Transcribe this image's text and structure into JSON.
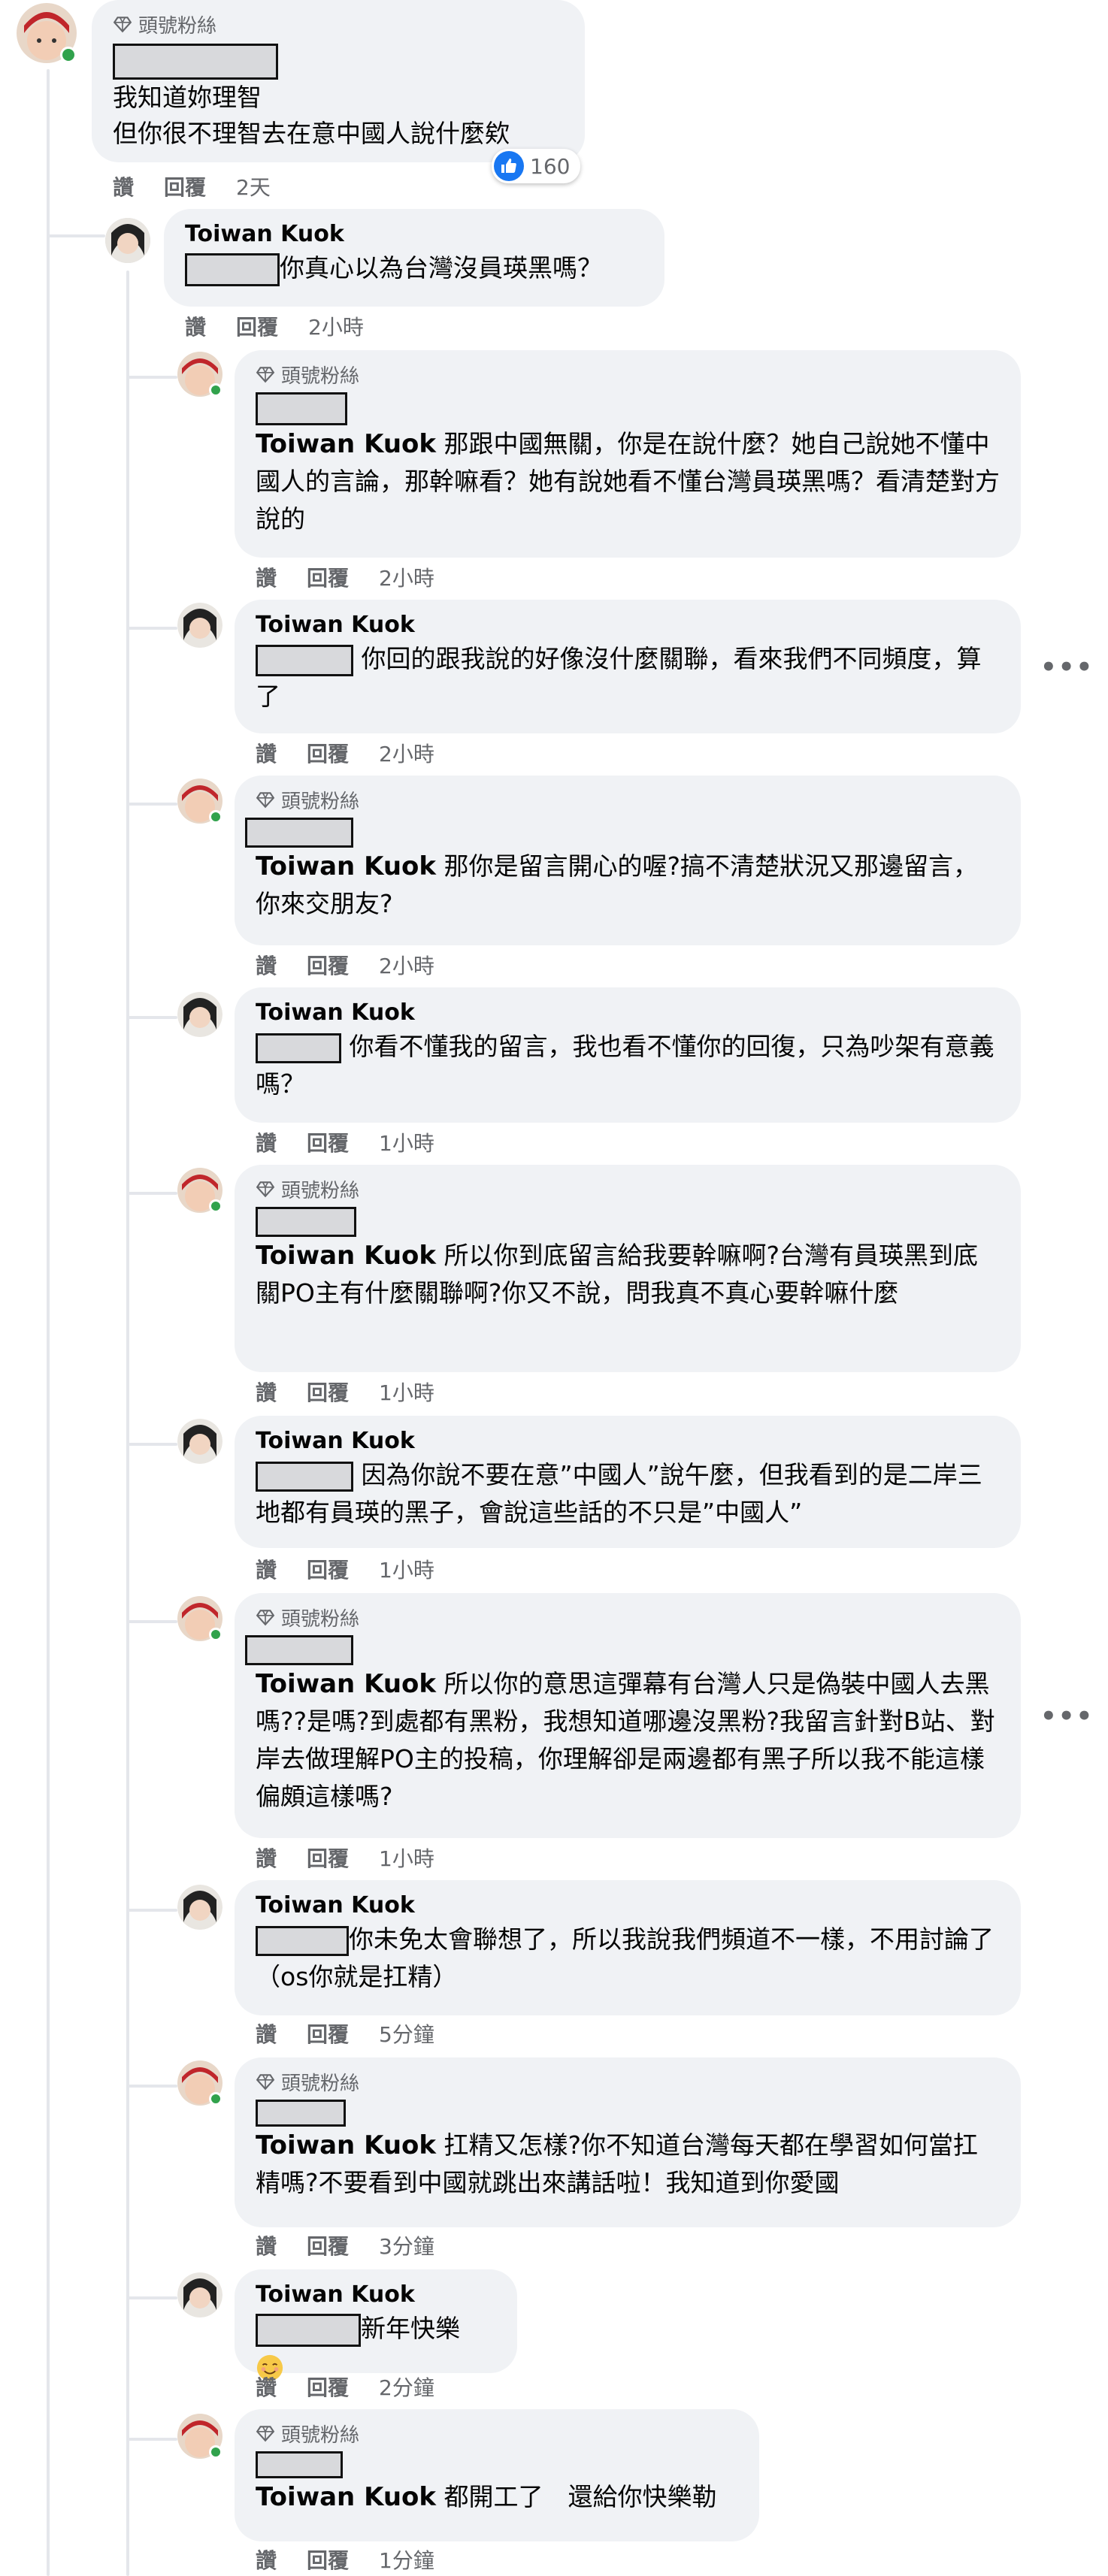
{
  "root_comment": {
    "badge": "頭號粉絲",
    "lines": [
      "我知道妳理智",
      "但你很不理智去在意中國人說什麼欸"
    ],
    "likes": "160",
    "actions": {
      "like": "讚",
      "reply": "回覆",
      "time": "2天"
    }
  },
  "replies": [
    {
      "type": "toiwan",
      "author": "Toiwan Kuok",
      "text": "你真心以為台灣沒員瑛黑嗎？",
      "like": "讚",
      "reply": "回覆",
      "time": "2小時"
    },
    {
      "type": "fan",
      "badge": "頭號粉絲",
      "tag": "Toiwan Kuok",
      "text": "那跟中國無關，你是在說什麼？她自己說她不懂中國人的言論，那幹嘛看？她有說她看不懂台灣員瑛黑嗎？看清楚對方說的",
      "like": "讚",
      "reply": "回覆",
      "time": "2小時"
    },
    {
      "type": "toiwan",
      "author": "Toiwan Kuok",
      "text": "你回的跟我說的好像沒什麼關聯，看來我們不同頻度，算了",
      "like": "讚",
      "reply": "回覆",
      "time": "2小時"
    },
    {
      "type": "fan",
      "badge": "頭號粉絲",
      "tag": "Toiwan Kuok",
      "text": "那你是留言開心的喔?搞不清楚狀況又那邊留言，你來交朋友?",
      "like": "讚",
      "reply": "回覆",
      "time": "2小時"
    },
    {
      "type": "toiwan",
      "author": "Toiwan Kuok",
      "text": "你看不懂我的留言，我也看不懂你的回復，只為吵架有意義嗎？",
      "like": "讚",
      "reply": "回覆",
      "time": "1小時"
    },
    {
      "type": "fan",
      "badge": "頭號粉絲",
      "tag": "Toiwan Kuok",
      "text": "所以你到底留言給我要幹嘛啊?台灣有員瑛黑到底關PO主有什麼關聯啊?你又不說，問我真不真心要幹嘛什麼",
      "like": "讚",
      "reply": "回覆",
      "time": "1小時"
    },
    {
      "type": "toiwan",
      "author": "Toiwan Kuok",
      "text": "因為你說不要在意”中國人”說午麼，但我看到的是二岸三地都有員瑛的黑子，會說這些話的不只是”中國人”",
      "like": "讚",
      "reply": "回覆",
      "time": "1小時"
    },
    {
      "type": "fan",
      "badge": "頭號粉絲",
      "tag": "Toiwan Kuok",
      "text": "所以你的意思這彈幕有台灣人只是偽裝中國人去黑嗎??是嗎?到處都有黑粉，我想知道哪邊沒黑粉?我留言針對B站、對岸去做理解PO主的投稿，你理解卻是兩邊都有黑子所以我不能這樣偏頗這樣嗎?",
      "like": "讚",
      "reply": "回覆",
      "time": "1小時"
    },
    {
      "type": "toiwan",
      "author": "Toiwan Kuok",
      "text": "你未免太會聯想了，所以我說我們頻道不一樣，不用討論了（os你就是扛精）",
      "like": "讚",
      "reply": "回覆",
      "time": "5分鐘"
    },
    {
      "type": "fan",
      "badge": "頭號粉絲",
      "tag": "Toiwan Kuok",
      "text": "扛精又怎樣?你不知道台灣每天都在學習如何當扛精嗎?不要看到中國就跳出來講話啦！我知道到你愛國",
      "like": "讚",
      "reply": "回覆",
      "time": "3分鐘"
    },
    {
      "type": "toiwan",
      "author": "Toiwan Kuok",
      "text": "新年快樂",
      "like": "讚",
      "reply": "回覆",
      "time": "2分鐘"
    },
    {
      "type": "fan",
      "badge": "頭號粉絲",
      "tag": "Toiwan Kuok",
      "text": "都開工了　還給你快樂勒",
      "like": "讚",
      "reply": "回覆",
      "time": "1分鐘"
    }
  ],
  "colors": {
    "bubble": "#f0f2f5",
    "secondary_text": "#65676b",
    "online": "#31a24c",
    "like_blue": "#1877f2"
  }
}
